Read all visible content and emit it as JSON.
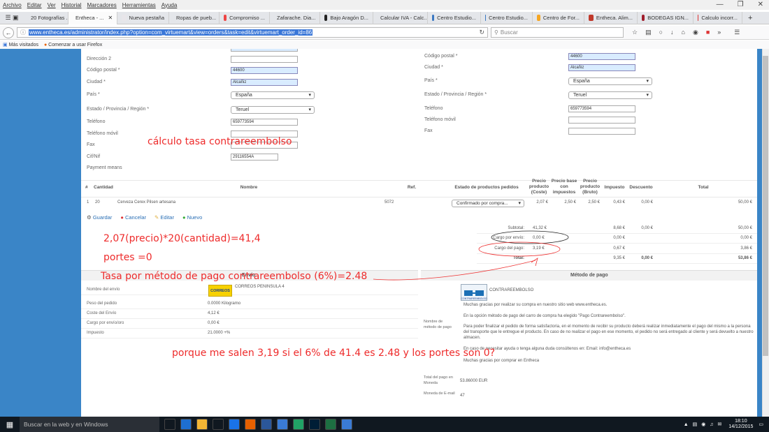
{
  "menu": [
    "Archivo",
    "Editar",
    "Ver",
    "Historial",
    "Marcadores",
    "Herramientas",
    "Ayuda"
  ],
  "window_controls": [
    "—",
    "❐",
    "✕"
  ],
  "tabs": [
    {
      "label": "20 Fotografías ...",
      "color": "#e8a83c"
    },
    {
      "label": "Entheca - ...",
      "color": "#3b78c2",
      "active": true,
      "close": "✕"
    },
    {
      "label": "Nueva pestaña",
      "color": "#e8e6ea"
    },
    {
      "label": "Ropas de pueb...",
      "color": "#3b5998"
    },
    {
      "label": "Compromiso ...",
      "color": "#e44"
    },
    {
      "label": "Zafarache. Dia...",
      "color": "#e67e22"
    },
    {
      "label": "Bajo Aragón D...",
      "color": "#222"
    },
    {
      "label": "Calcular IVA - Calc...",
      "color": "#e8e6ea"
    },
    {
      "label": "Centro Estudio...",
      "color": "#3b78c2"
    },
    {
      "label": "Centro Estudio...",
      "color": "#3b78c2"
    },
    {
      "label": "Centro de For...",
      "color": "#f5a623"
    },
    {
      "label": "Entheca. Alim...",
      "color": "#c0392b"
    },
    {
      "label": "BODEGAS IGN...",
      "color": "#a01d2c"
    },
    {
      "label": "Calculo incorr...",
      "color": "#d33"
    }
  ],
  "new_tab": "+",
  "url": "www.entheca.es/administrator/index.php?option=com_virtuemart&view=orders&task=edit&virtuemart_order_id=86",
  "search_placeholder": "Buscar",
  "bookmarks": [
    "Más visitados",
    "Comenzar a usar Firefox"
  ],
  "form_left": {
    "rows": [
      {
        "label": "Dirección 2",
        "value": ""
      },
      {
        "label": "Código postal *",
        "value": "44600"
      },
      {
        "label": "Ciudad *",
        "value": "Alcañiz"
      },
      {
        "label": "País *",
        "value": "España"
      },
      {
        "label": "Estado / Provincia / Región *",
        "value": "Teruel"
      },
      {
        "label": "Teléfono",
        "value": "659773594"
      },
      {
        "label": "Teléfono móvil",
        "value": ""
      },
      {
        "label": "Fax",
        "value": ""
      },
      {
        "label": "Cif/Nif",
        "value": "29116554A"
      },
      {
        "label": "Payment means",
        "value": ""
      }
    ]
  },
  "form_right": {
    "rows": [
      {
        "label": "Código postal *",
        "value": "44600"
      },
      {
        "label": "Ciudad *",
        "value": "Alcañiz"
      },
      {
        "label": "País *",
        "value": "España"
      },
      {
        "label": "Estado / Provincia / Región *",
        "value": "Teruel"
      },
      {
        "label": "Teléfono",
        "value": "659773594"
      },
      {
        "label": "Teléfono móvil",
        "value": ""
      },
      {
        "label": "Fax",
        "value": ""
      }
    ]
  },
  "items_table": {
    "headers": [
      "#",
      "Cantidad",
      "Nombre",
      "Ref.",
      "Estado de productos pedidos",
      "Precio producto (Coste)",
      "Precio base con impuestos",
      "Precio producto (Bruto)",
      "Impuesto",
      "Descuento",
      "Total"
    ],
    "row": {
      "num": "1",
      "qty": "20",
      "name": "Cerveza Cerex Pilsen artesana",
      "ref": "5072",
      "status": "Confirmado por compra...",
      "cost": "2,07 €",
      "base": "2,50 €",
      "gross": "2,50 €",
      "tax": "0,43 €",
      "discount": "0,00 €",
      "total": "50,00 €"
    }
  },
  "actions": {
    "save": "Guardar",
    "cancel": "Cancelar",
    "edit": "Editar",
    "new": "Nuevo"
  },
  "totals": [
    {
      "label": "Subtotal:",
      "value": "41,32 €",
      "tax": "8,68 €",
      "discount": "0,00 €",
      "total": "50,00 €"
    },
    {
      "label": "Cargo por envío:",
      "value": "0,00 €",
      "tax": "0,00 €",
      "discount": "",
      "total": "0,00 €"
    },
    {
      "label": "Cargo del pago:",
      "value": "3,19 €",
      "tax": "0,67 €",
      "discount": "",
      "total": "3,86 €"
    },
    {
      "label": "Total:",
      "value": "",
      "tax": "9,35 €",
      "discount": "0,00 €",
      "total": "53,86 €"
    }
  ],
  "shipping": {
    "header": "Envío",
    "rows": [
      {
        "label": "Nombre del envío",
        "value": "CORREOS PENINSULA 4"
      },
      {
        "label": "Peso del pedido",
        "value": "0.0000 Kilogramo"
      },
      {
        "label": "Coste del Envío",
        "value": "4,12 €"
      },
      {
        "label": "Cargo por envío/oro",
        "value": "0,00 €"
      },
      {
        "label": "Impuesto",
        "value": "21.0000 +%"
      }
    ],
    "logo_text": "CORREOS"
  },
  "payment": {
    "header": "Método de pago",
    "name_label": "Nombre de método de pago",
    "method_name": "CONTRAREEMBOLSO",
    "logo_text": "CONTRAREEMBOLSO",
    "lines": [
      "Muchas gracias por realizar su compra en nuestro sitio web www.entheca.es.",
      "En la opción método de pago del carro de compra ha elegido \"Pago Contrareembolso\".",
      "Para poder finalizar el pedido de forma satisfactoria, en el momento de recibir su producto deberá realizar inmediatamente el pago del mismo a la persona del transporte que le entregue el producto. En caso de no realizar el pago en ese momento, el pedido no será entregado al cliente y será devuelto a nuestro almacen.",
      "En caso de necesitar ayuda o tenga alguna duda consúltenos en: Email: info@entheca.es",
      "Muchas gracias por comprar en Entheca"
    ],
    "total_label": "Total del pago en Moneda",
    "total_value": "53.86000 EUR",
    "currency_label": "Moneda de E-mail",
    "currency_value": "47"
  },
  "annotations": {
    "a1": "cálculo tasa contrareembolso",
    "a2": "2,07(precio)*20(cantidad)=41,4",
    "a3": "portes =0",
    "a4": "Tasa por método de pago contrareembolso (6%)=2.48",
    "a5": "porque me salen 3,19 si el 6% de 41.4 es 2.48 y los portes son 0?"
  },
  "taskbar": {
    "search": "Buscar en la web y en Windows",
    "time": "18:10",
    "date": "14/12/2015",
    "icons": [
      {
        "name": "task-view-icon",
        "color": "#101820"
      },
      {
        "name": "edge-icon",
        "color": "#1e6fd1"
      },
      {
        "name": "explorer-icon",
        "color": "#f2b534"
      },
      {
        "name": "store-icon",
        "color": "#101820"
      },
      {
        "name": "chrome-icon",
        "color": "#1a73e8"
      },
      {
        "name": "firefox-icon",
        "color": "#e66000"
      },
      {
        "name": "word-icon",
        "color": "#2b579a"
      },
      {
        "name": "app-icon",
        "color": "#3a7bd5"
      },
      {
        "name": "excel-green-icon",
        "color": "#21a366"
      },
      {
        "name": "photoshop-icon",
        "color": "#001e36"
      },
      {
        "name": "excel-icon",
        "color": "#1d6f42"
      },
      {
        "name": "app2-icon",
        "color": "#3a7bd5"
      }
    ]
  }
}
